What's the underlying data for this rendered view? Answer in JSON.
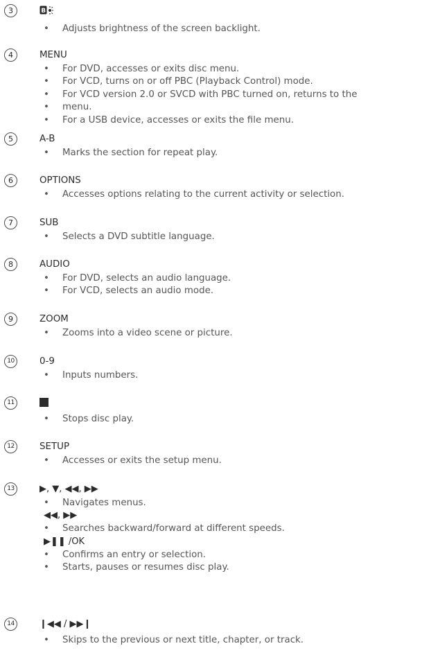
{
  "entries": [
    {
      "n": "3",
      "label": "",
      "icon": "brightness-icon",
      "bullets": [
        "Adjusts brightness of the screen backlight."
      ]
    },
    {
      "n": "4",
      "label": "MENU",
      "bullets": [
        "For DVD, accesses or exits disc menu.",
        "For VCD, turns on or off PBC (Playback Control) mode.",
        "For VCD version 2.0 or SVCD with PBC turned on, returns to the",
        "For a USB device, accesses or exits the file menu."
      ],
      "wrap": "menu."
    },
    {
      "n": "5",
      "label": "A-B",
      "bullets": [
        "Marks the section for repeat play."
      ]
    },
    {
      "n": "6",
      "label": "OPTIONS",
      "bullets": [
        "Accesses options relating to the current activity or selection."
      ]
    },
    {
      "n": "7",
      "label": "SUB",
      "bullets": [
        "Selects a DVD subtitle language."
      ]
    },
    {
      "n": "8",
      "label": "AUDIO",
      "bullets": [
        "For DVD, selects an audio language.",
        "For VCD, selects an audio mode."
      ]
    },
    {
      "n": "9",
      "label": "ZOOM",
      "bullets": [
        "Zooms into a video scene or picture."
      ]
    },
    {
      "n": "10",
      "label": "0-9",
      "bullets": [
        "Inputs numbers."
      ]
    },
    {
      "n": "11",
      "label": "",
      "icon": "stop-icon",
      "bullets": [
        "Stops disc play."
      ]
    },
    {
      "n": "12",
      "label": "SETUP",
      "bullets": [
        "Accesses or exits the setup menu."
      ]
    },
    {
      "n": "13",
      "label": "▶, ▼, ◀◀, ▶▶",
      "bullets": [
        "Navigates menus."
      ],
      "sub1": "◀◀, ▶▶",
      "bullets2": [
        "Searches backward/forward at different speeds."
      ],
      "sub2": "▶❚❚ /OK",
      "bullets3": [
        "Confirms an entry or selection.",
        "Starts, pauses or resumes disc play."
      ]
    },
    {
      "n": "14",
      "label": "❙◀◀ / ▶▶❙",
      "bullets": [
        "Skips to the previous or next title, chapter, or track."
      ]
    }
  ]
}
